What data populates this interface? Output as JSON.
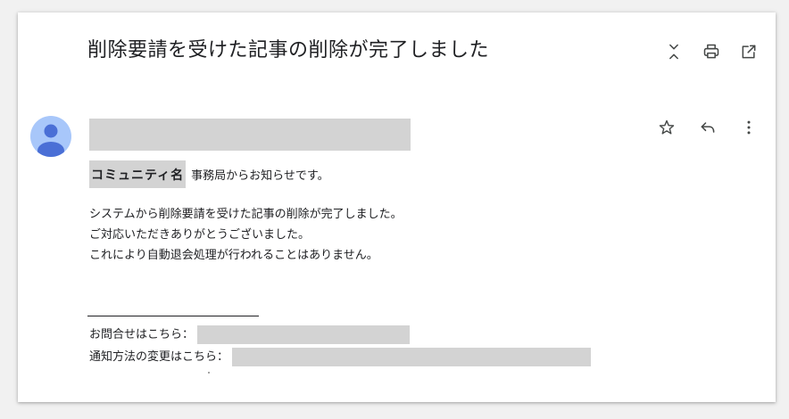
{
  "email": {
    "subject": "削除要請を受けた記事の削除が完了しました",
    "community_name": "コミュニティ名",
    "intro": "事務局からお知らせです。",
    "body_lines": [
      "システムから削除要請を受けた記事の削除が完了しました。",
      "ご対応いただきありがとうございました。",
      "これにより自動退会処理が行われることはありません。"
    ],
    "footer": {
      "contact_label": "お問合せはこちら：",
      "notification_label": "通知方法の変更はこちら："
    }
  },
  "icons": {
    "collapse": "collapse-all-icon",
    "print": "print-icon",
    "open_new": "open-in-new-window-icon",
    "star": "star-icon",
    "reply": "reply-icon",
    "more": "more-vertical-icon",
    "avatar": "person-avatar-icon"
  },
  "colors": {
    "avatar_bg": "#a8c7fa",
    "avatar_fg": "#4a6fd6",
    "redaction": "#d3d3d3",
    "icon": "#444746"
  }
}
